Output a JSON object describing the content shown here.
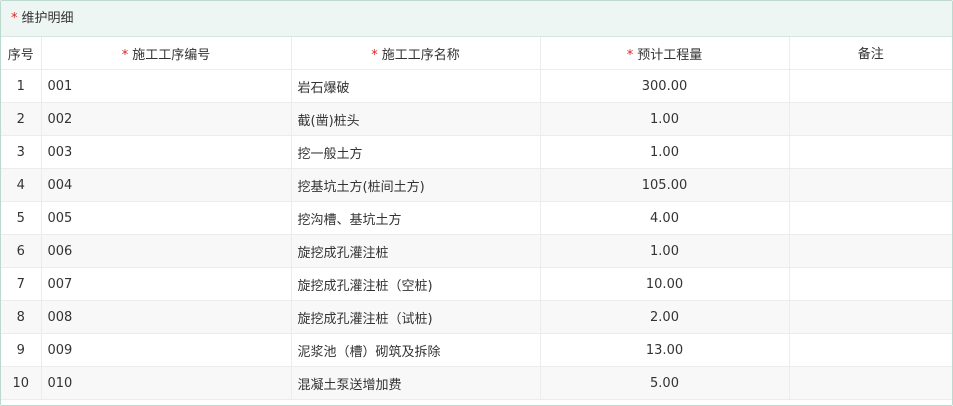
{
  "section": {
    "required_mark": "*",
    "title": "维护明细"
  },
  "table": {
    "columns": {
      "index": "序号",
      "code": "施工工序编号",
      "name": "施工工序名称",
      "quantity": "预计工程量",
      "remark": "备注"
    },
    "required_mark": "*",
    "rows": [
      {
        "index": "1",
        "code": "001",
        "name": "岩石爆破",
        "quantity": "300.00",
        "remark": ""
      },
      {
        "index": "2",
        "code": "002",
        "name": "截(凿)桩头",
        "quantity": "1.00",
        "remark": ""
      },
      {
        "index": "3",
        "code": "003",
        "name": "挖一般土方",
        "quantity": "1.00",
        "remark": ""
      },
      {
        "index": "4",
        "code": "004",
        "name": "挖基坑土方(桩间土方)",
        "quantity": "105.00",
        "remark": ""
      },
      {
        "index": "5",
        "code": "005",
        "name": "挖沟槽、基坑土方",
        "quantity": "4.00",
        "remark": ""
      },
      {
        "index": "6",
        "code": "006",
        "name": "旋挖成孔灌注桩",
        "quantity": "1.00",
        "remark": ""
      },
      {
        "index": "7",
        "code": "007",
        "name": "旋挖成孔灌注桩（空桩)",
        "quantity": "10.00",
        "remark": ""
      },
      {
        "index": "8",
        "code": "008",
        "name": "旋挖成孔灌注桩（试桩)",
        "quantity": "2.00",
        "remark": ""
      },
      {
        "index": "9",
        "code": "009",
        "name": "泥浆池（槽）砌筑及拆除",
        "quantity": "13.00",
        "remark": ""
      },
      {
        "index": "10",
        "code": "010",
        "name": "混凝土泵送增加费",
        "quantity": "5.00",
        "remark": ""
      }
    ]
  },
  "colors": {
    "header_bg": "#edf6f3",
    "border": "#bcd9d0",
    "required": "#e02020",
    "stripe": "#f8f8f8"
  }
}
